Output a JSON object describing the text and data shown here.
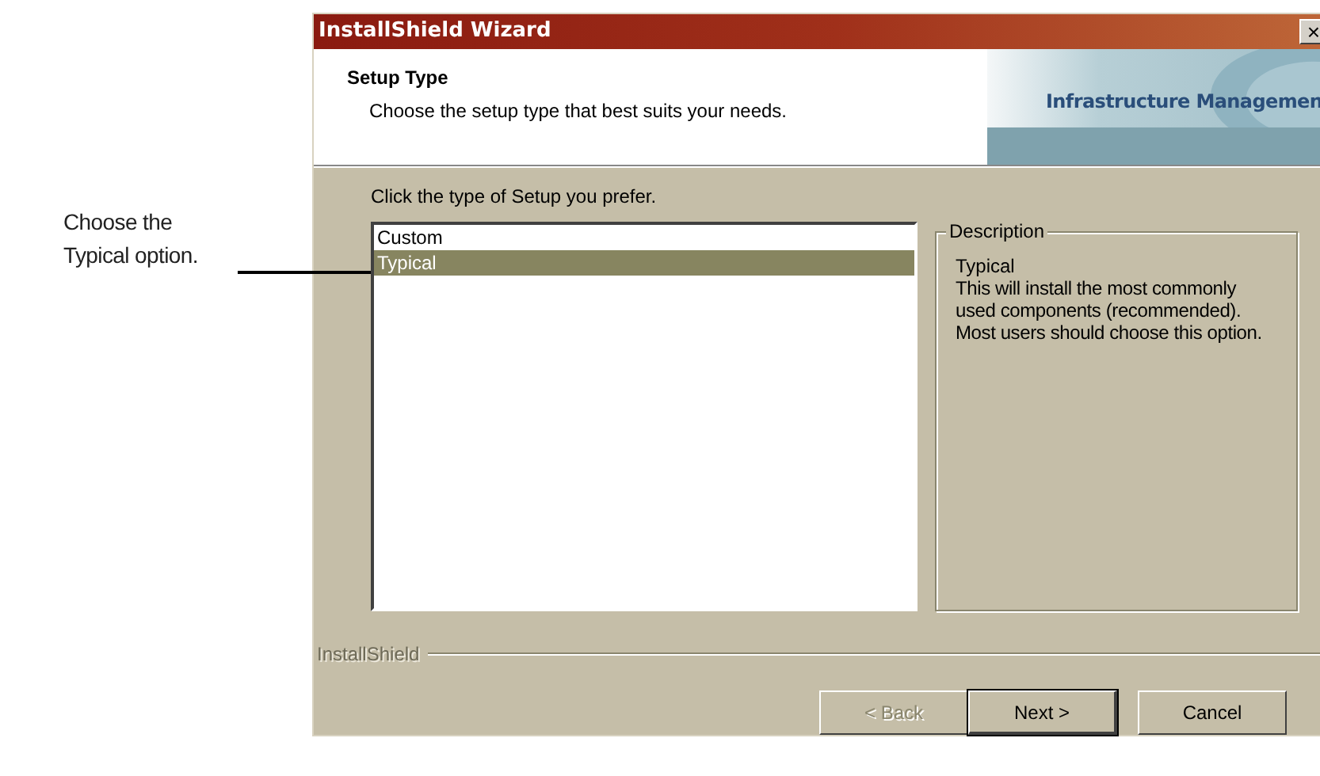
{
  "callout": {
    "text": "Choose the Typical option."
  },
  "window": {
    "title": "InstallShield Wizard",
    "close": "×"
  },
  "header": {
    "title": "Setup Type",
    "subtitle": "Choose the setup type that best suits your needs.",
    "banner": "Infrastructure Managemen"
  },
  "prompt": "Click the type of Setup you prefer.",
  "setup_types": [
    {
      "label": "Custom",
      "selected": false
    },
    {
      "label": "Typical",
      "selected": true
    }
  ],
  "description": {
    "legend": "Description",
    "title": "Typical",
    "text": "This will install the most commonly used components (recommended). Most users should choose this option."
  },
  "brand": "InstallShield",
  "buttons": [
    {
      "label": "< Back",
      "disabled": true,
      "default": false
    },
    {
      "label": "Next >",
      "disabled": false,
      "default": true
    },
    {
      "label": "Cancel",
      "disabled": false,
      "default": false
    }
  ]
}
